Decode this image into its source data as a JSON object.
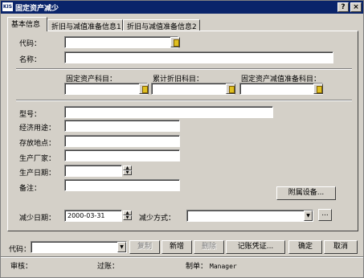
{
  "window": {
    "title": "固定资产减少",
    "app_icon_text": "KIS"
  },
  "titlebar_buttons": {
    "help": "?",
    "close": "×"
  },
  "tabs": [
    {
      "label": "基本信息",
      "active": true
    },
    {
      "label": "折旧与减值准备信息1",
      "active": false
    },
    {
      "label": "折旧与减值准备信息2",
      "active": false
    }
  ],
  "form": {
    "code_label": "代码：",
    "code_value": "",
    "name_label": "名称：",
    "name_value": "",
    "asset_account_label": "固定资产科目：",
    "asset_account_value": "",
    "depr_account_label": "累计折旧科目：",
    "depr_account_value": "",
    "impair_account_label": "固定资产减值准备科目：",
    "impair_account_value": "",
    "model_label": "型号：",
    "model_value": "",
    "usage_label": "经济用途：",
    "usage_value": "",
    "location_label": "存放地点：",
    "location_value": "",
    "manufacturer_label": "生产厂家：",
    "manufacturer_value": "",
    "prod_date_label": "生产日期：",
    "prod_date_value": "",
    "remark_label": "备注：",
    "remark_value": "",
    "attached_button": "附属设备...",
    "reduce_date_label": "减少日期：",
    "reduce_date_value": "2000-03-31",
    "reduce_method_label": "减少方式：",
    "reduce_method_value": "",
    "more_button": "..."
  },
  "bottom": {
    "code_label": "代码：",
    "code_value": "",
    "copy_button": "复制",
    "new_button": "新增",
    "delete_button": "删除",
    "voucher_button": "记账凭证...",
    "ok_button": "确定",
    "cancel_button": "取消"
  },
  "status": {
    "auditor_label": "审核：",
    "auditor_value": "",
    "poster_label": "过账：",
    "poster_value": "",
    "maker_label": "制单：",
    "maker_value": "Manager"
  }
}
